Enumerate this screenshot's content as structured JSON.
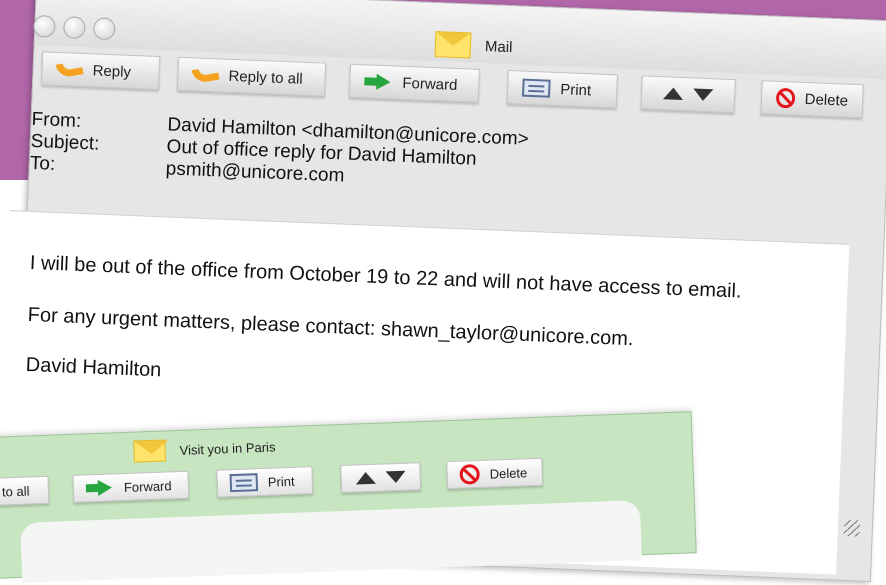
{
  "mail": {
    "title": "Mail",
    "toolbar": {
      "reply": "Reply",
      "reply_all": "Reply to all",
      "forward": "Forward",
      "print": "Print",
      "delete": "Delete"
    },
    "header": {
      "from_label": "From:",
      "subject_label": "Subject:",
      "to_label": "To:",
      "from": "David Hamilton <dhamilton@unicore.com>",
      "subject": "Out of office reply for David Hamilton",
      "to": "psmith@unicore.com"
    },
    "body": {
      "line1": "I will be out of the office from October 19 to 22 and will not have access to email.",
      "line2": "For any urgent matters, please contact: shawn_taylor@unicore.com.",
      "signature": "David Hamilton"
    }
  },
  "second_mail": {
    "title": "Visit you in Paris",
    "toolbar": {
      "reply_all": "to all",
      "forward": "Forward",
      "print": "Print",
      "delete": "Delete"
    }
  },
  "colors": {
    "background": "#b066a8",
    "window_gray": "#e6e6e6",
    "window_green": "#c7e5c1",
    "forward_green": "#27a640",
    "reply_orange": "#f4a21f",
    "delete_red": "#e3141c"
  },
  "icons": [
    "envelope-icon",
    "reply-icon",
    "reply-all-icon",
    "forward-icon",
    "print-icon",
    "up-arrow-icon",
    "down-arrow-icon",
    "delete-icon",
    "resize-grip-icon"
  ]
}
